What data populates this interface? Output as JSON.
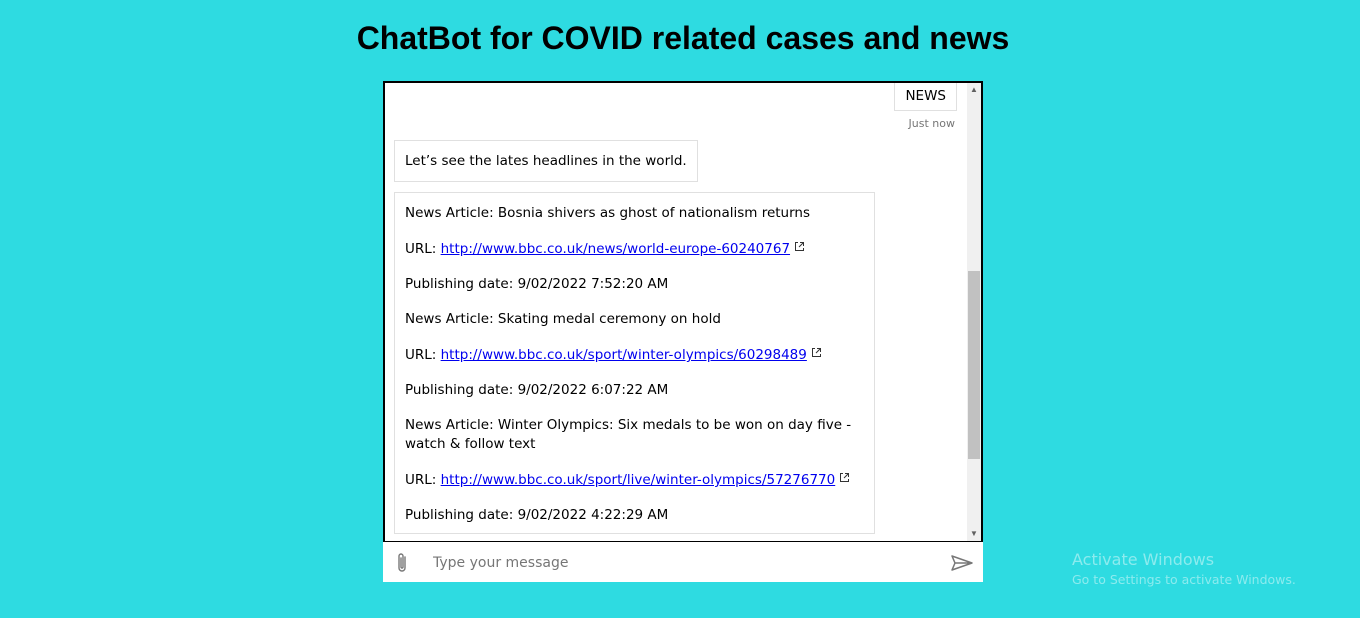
{
  "page": {
    "title": "ChatBot for COVID related cases and news"
  },
  "chat": {
    "user_message": {
      "text": "NEWS",
      "timestamp": "Just now"
    },
    "bot_greeting": "Let’s see the lates headlines in the world.",
    "articles": [
      {
        "title_line": "News Article: Bosnia shivers as ghost of nationalism returns",
        "url_label": "URL:",
        "url": "http://www.bbc.co.uk/news/world-europe-60240767",
        "date_line": "Publishing date: 9/02/2022 7:52:20 AM"
      },
      {
        "title_line": "News Article: Skating medal ceremony on hold",
        "url_label": "URL:",
        "url": "http://www.bbc.co.uk/sport/winter-olympics/60298489",
        "date_line": "Publishing date: 9/02/2022 6:07:22 AM"
      },
      {
        "title_line": "News Article: Winter Olympics: Six medals to be won on day five - watch & follow text",
        "url_label": "URL:",
        "url": "http://www.bbc.co.uk/sport/live/winter-olympics/57276770",
        "date_line": "Publishing date: 9/02/2022 4:22:29 AM"
      }
    ],
    "scroll_fraction": 0.72
  },
  "input": {
    "placeholder": "Type your message",
    "value": ""
  },
  "icons": {
    "attach": "paperclip-icon",
    "send": "send-icon",
    "external_link": "external-link-icon",
    "scroll_up": "arrow-up-icon",
    "scroll_down": "arrow-down-icon"
  },
  "watermark": {
    "title": "Activate Windows",
    "subtitle": "Go to Settings to activate Windows."
  },
  "colors": {
    "background": "#2edbe1",
    "link": "#0000ee"
  }
}
